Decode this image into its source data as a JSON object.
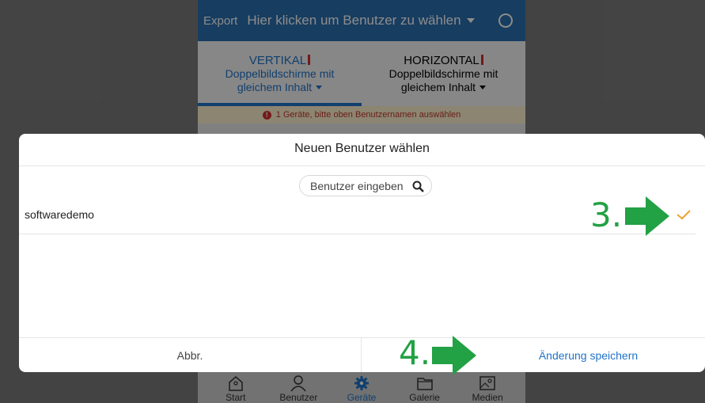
{
  "header": {
    "export_label": "Export",
    "user_select_label": "Hier klicken um Benutzer zu wählen"
  },
  "modes": [
    {
      "title": "VERTIKAL",
      "subtitle1": "Doppelbildschirme mit",
      "subtitle2": "gleichem Inhalt"
    },
    {
      "title": "HORIZONTAL",
      "subtitle1": "Doppelbildschirme mit",
      "subtitle2": "gleichem Inhalt"
    }
  ],
  "warning": {
    "icon": "!",
    "text": "1 Geräte, bitte oben Benutzernamen auswählen"
  },
  "modal": {
    "title": "Neuen Benutzer wählen",
    "search_placeholder": "Benutzer eingeben",
    "users": [
      {
        "name": "softwaredemo",
        "selected": true
      }
    ],
    "cancel_label": "Abbr.",
    "save_label": "Änderung speichern"
  },
  "annotations": {
    "step3": "3.",
    "step4": "4."
  },
  "bottom_nav": [
    {
      "label": "Start",
      "icon": "home-icon"
    },
    {
      "label": "Benutzer",
      "icon": "user-icon"
    },
    {
      "label": "Geräte",
      "icon": "gear-icon",
      "active": true
    },
    {
      "label": "Galerie",
      "icon": "folder-icon"
    },
    {
      "label": "Medien",
      "icon": "image-icon"
    }
  ],
  "colors": {
    "accent": "#1f73c8",
    "topbar": "#2a6fb0",
    "warning": "#d32f2f",
    "check": "#f0a030",
    "annotation": "#22a145"
  }
}
